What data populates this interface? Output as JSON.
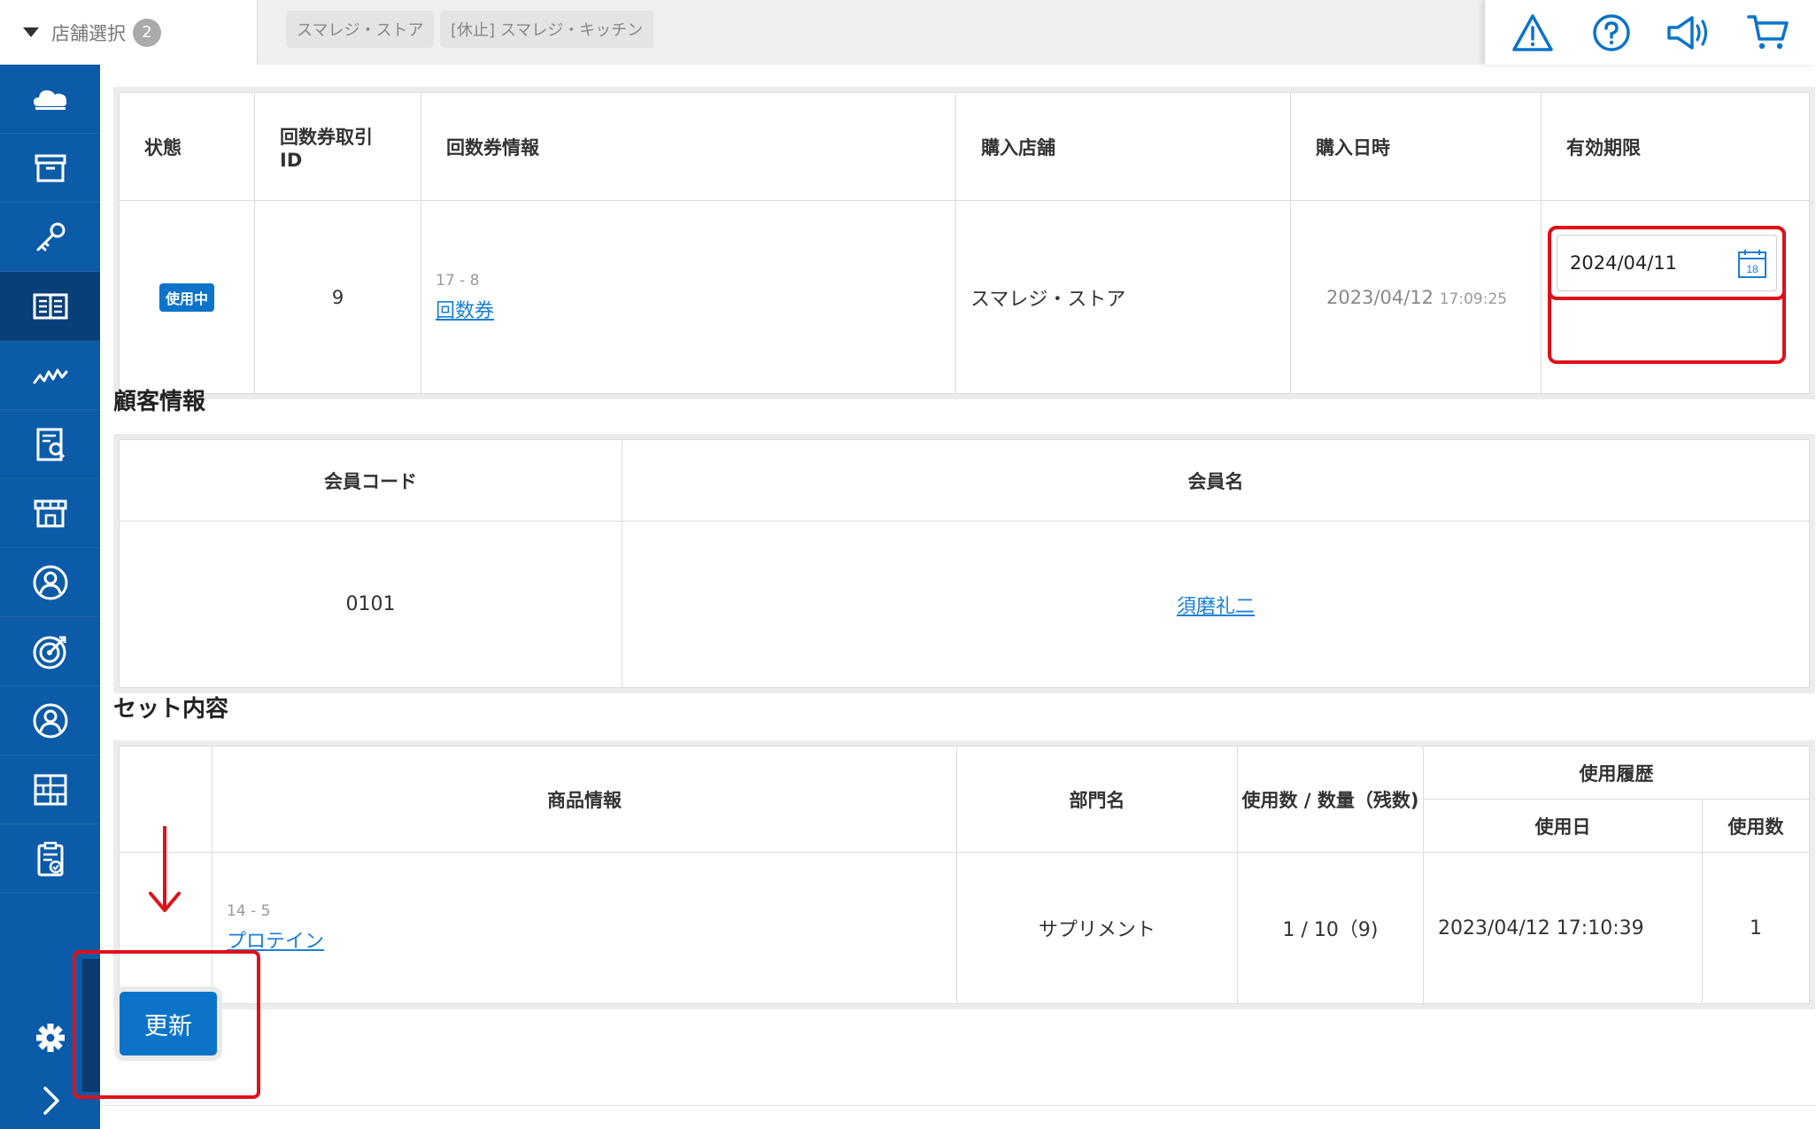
{
  "topbar": {
    "store_select_label": "店舗選択",
    "store_count": "2",
    "stores": [
      "スマレジ・ストア",
      "[休止] スマレジ・キッチン"
    ],
    "icons": [
      "alert-icon",
      "help-icon",
      "announcement-icon",
      "cart-icon"
    ]
  },
  "sidebar": {
    "items": [
      "cloud-icon",
      "archive-icon",
      "key-icon",
      "book-icon",
      "chart-line-icon",
      "report-icon",
      "store-icon",
      "customer-icon",
      "target-icon",
      "user-icon",
      "grid-icon",
      "clipboard-icon"
    ],
    "active": "book-icon",
    "footer": [
      "gear-icon",
      "chevron-right-icon"
    ],
    "color": "#0b5ba8"
  },
  "ticket_table": {
    "headers": [
      "状態",
      "回数券取引\nID",
      "回数券情報",
      "購入店舗",
      "購入日時",
      "有効期限"
    ],
    "row": {
      "status": "使用中",
      "id": "9",
      "info_code": "17 - 8",
      "info_name": "回数券",
      "store": "スマレジ・ストア",
      "date": "2023/04/12",
      "time": "17:09:25",
      "expiry": "2024/04/11",
      "calendar_day": "18"
    }
  },
  "customer": {
    "title": "顧客情報",
    "headers": [
      "会員コード",
      "会員名"
    ],
    "code": "0101",
    "name": "須磨礼二"
  },
  "set_contents": {
    "title": "セット内容",
    "headers": {
      "product": "商品情報",
      "dept": "部門名",
      "usage": "使用数 / 数量（残数)",
      "history": "使用履歴",
      "used_date": "使用日",
      "used_count": "使用数"
    },
    "row": {
      "code": "14 - 5",
      "name": "プロテイン",
      "dept": "サプリメント",
      "usage": "1 / 10（9)",
      "used_date": "2023/04/12 17:10:39",
      "used_count": "1"
    }
  },
  "update_button": "更新",
  "accent_color": "#0b74c9",
  "highlight_color": "#e0101a"
}
